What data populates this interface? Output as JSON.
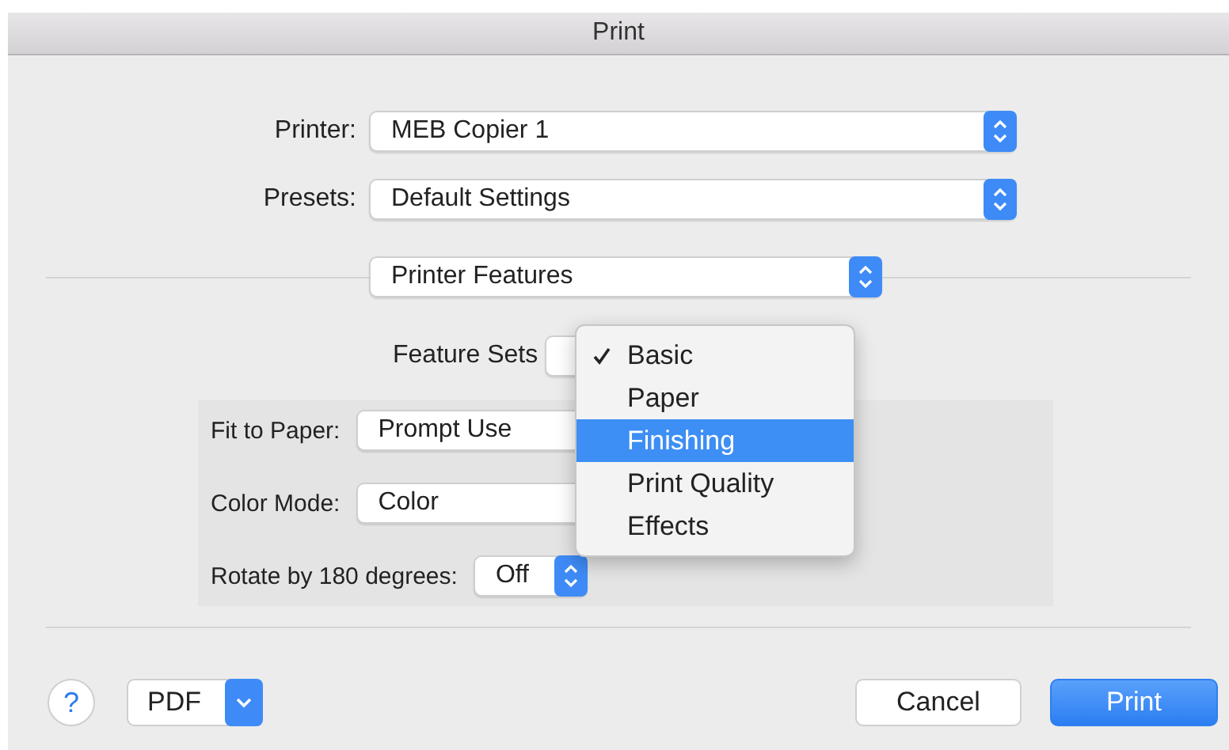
{
  "window": {
    "title": "Print"
  },
  "fields": [
    {
      "label": "Printer:",
      "value": "MEB Copier 1"
    },
    {
      "label": "Presets:",
      "value": "Default Settings"
    }
  ],
  "section_popup": {
    "value": "Printer Features"
  },
  "feature_sets": {
    "label": "Feature Sets",
    "menu": [
      {
        "label": "Basic",
        "selected": true,
        "highlighted": false
      },
      {
        "label": "Paper",
        "selected": false,
        "highlighted": false
      },
      {
        "label": "Finishing",
        "selected": false,
        "highlighted": true
      },
      {
        "label": "Print Quality",
        "selected": false,
        "highlighted": false
      },
      {
        "label": "Effects",
        "selected": false,
        "highlighted": false
      }
    ]
  },
  "options": [
    {
      "label": "Fit to Paper:",
      "value": "Prompt Use",
      "kind": "wide"
    },
    {
      "label": "Color Mode:",
      "value": "Color",
      "kind": "wide"
    },
    {
      "label": "Rotate by 180 degrees:",
      "value": "Off",
      "kind": "compact"
    }
  ],
  "buttons": {
    "help": "?",
    "pdf": "PDF",
    "cancel": "Cancel",
    "print": "Print"
  }
}
